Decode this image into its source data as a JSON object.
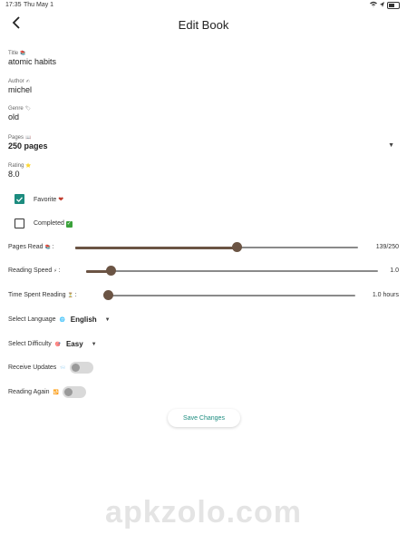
{
  "status_bar": {
    "time": "17:35",
    "date": "Thu May 1"
  },
  "app_bar": {
    "title": "Edit Book",
    "back_icon": "chevron-left-icon"
  },
  "fields": {
    "title": {
      "label": "Title",
      "value": "atomic habits",
      "emoji": "📚"
    },
    "author": {
      "label": "Author",
      "value": "michel",
      "emoji": "✍"
    },
    "genre": {
      "label": "Genre",
      "value": "old",
      "emoji": "🏷"
    },
    "pages": {
      "label": "Pages",
      "value": "250 pages",
      "emoji": "📖"
    },
    "rating": {
      "label": "Rating",
      "value": "8.0",
      "emoji": "⭐"
    }
  },
  "checkboxes": {
    "favorite": {
      "label": "Favorite",
      "checked": true,
      "badge": "❤"
    },
    "completed": {
      "label": "Completed",
      "checked": false,
      "badge": "✓"
    }
  },
  "sliders": {
    "pages_read": {
      "label": "Pages Read",
      "emoji": "📚",
      "value_text": "139/250",
      "fraction": 0.556
    },
    "reading_speed": {
      "label": "Reading Speed",
      "emoji": "⚡",
      "value_text": "1.0",
      "fraction": 0.0
    },
    "time_spent": {
      "label": "Time Spent Reading",
      "emoji": "⏳",
      "value_text": "1.0 hours",
      "fraction": 0.0
    }
  },
  "selects": {
    "language": {
      "label": "Select Language",
      "emoji": "🌐",
      "value": "English"
    },
    "difficulty": {
      "label": "Select Difficulty",
      "emoji": "🎯",
      "value": "Easy"
    }
  },
  "toggles": {
    "receive_updates": {
      "label": "Receive Updates",
      "emoji": "📨",
      "on": false
    },
    "reading_again": {
      "label": "Reading Again",
      "emoji": "🔁",
      "on": false
    }
  },
  "save_button": {
    "label": "Save Changes"
  },
  "watermark": "apkzolo.com",
  "colors": {
    "accent": "#1c8c7f",
    "slider": "#6b5444",
    "track": "#8a8a8a"
  }
}
